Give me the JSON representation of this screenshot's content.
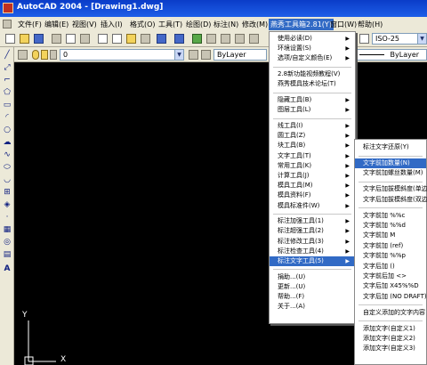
{
  "window": {
    "title": "AutoCAD 2004 - [Drawing1.dwg]"
  },
  "menubar": {
    "items": [
      "文件(F)",
      "编辑(E)",
      "视图(V)",
      "插入(I)",
      "格式(O)",
      "工具(T)",
      "绘图(D)",
      "标注(N)",
      "修改(M)",
      "燕秀工具箱2.81(Y)",
      "窗口(W)",
      "帮助(H)"
    ],
    "active_index": 9
  },
  "toolbar1": {
    "style_combo": "ISO-25"
  },
  "toolbar2": {
    "layer_combo": "0",
    "color_combo": "ByLayer",
    "linetype_combo": "ByLayer"
  },
  "canvas": {
    "axis_y_label": "Y",
    "axis_x_label": "X"
  },
  "main_menu": {
    "groups": [
      [
        {
          "label": "使用必读(D)",
          "arrow": true
        },
        {
          "label": "环境设置(S)",
          "arrow": true
        },
        {
          "label": "选项/自定义颜色(E)",
          "arrow": true
        }
      ],
      [
        {
          "label": "2.8新功能视频教程(V)",
          "arrow": false
        },
        {
          "label": "燕秀模具技术论坛(T)",
          "arrow": false
        }
      ],
      [
        {
          "label": "隐藏工具(B)",
          "arrow": true
        },
        {
          "label": "图层工具(L)",
          "arrow": true
        }
      ],
      [
        {
          "label": "线工具(I)",
          "arrow": true
        },
        {
          "label": "圆工具(Z)",
          "arrow": true
        },
        {
          "label": "块工具(B)",
          "arrow": true
        },
        {
          "label": "文字工具(T)",
          "arrow": true
        },
        {
          "label": "常用工具(K)",
          "arrow": true
        },
        {
          "label": "计算工具(J)",
          "arrow": true
        },
        {
          "label": "模具工具(M)",
          "arrow": true
        },
        {
          "label": "模具资料(F)",
          "arrow": true
        },
        {
          "label": "模具标准件(W)",
          "arrow": true
        }
      ],
      [
        {
          "label": "标注加强工具(1)",
          "arrow": true
        },
        {
          "label": "标注超强工具(2)",
          "arrow": true
        },
        {
          "label": "标注修改工具(3)",
          "arrow": true
        },
        {
          "label": "标注检查工具(4)",
          "arrow": true
        },
        {
          "label": "标注文字工具(5)",
          "arrow": true,
          "active": true
        }
      ],
      [
        {
          "label": "捐助...(U)",
          "arrow": false
        },
        {
          "label": "更新...(U)",
          "arrow": false
        },
        {
          "label": "帮助...(F)",
          "arrow": false
        },
        {
          "label": "关于...(A)",
          "arrow": false
        }
      ]
    ]
  },
  "sub_menu": {
    "groups": [
      [
        {
          "label": "标注文字还原(Y)"
        }
      ],
      [
        {
          "label": "文字前加数量(N)",
          "active": true
        },
        {
          "label": "文字前加螺丝数量(M)"
        }
      ],
      [
        {
          "label": "文字后加拔模斜度(单边)"
        },
        {
          "label": "文字后加拔模斜度(双边)"
        }
      ],
      [
        {
          "label": "文字前加 %%c"
        },
        {
          "label": "文字前加 %%d"
        },
        {
          "label": "文字前加 M"
        },
        {
          "label": "文字前加 (ref)"
        },
        {
          "label": "文字前加 %%p"
        },
        {
          "label": "文字后加 ()"
        },
        {
          "label": "文字前后加 <>"
        },
        {
          "label": "文字后加 X45%%D"
        },
        {
          "label": "文字后加 (NO DRAFT)"
        }
      ],
      [
        {
          "label": "自定义添加的文字内容"
        }
      ],
      [
        {
          "label": "添加文字(自定义1)"
        },
        {
          "label": "添加文字(自定义2)"
        },
        {
          "label": "添加文字(自定义3)"
        }
      ]
    ]
  }
}
